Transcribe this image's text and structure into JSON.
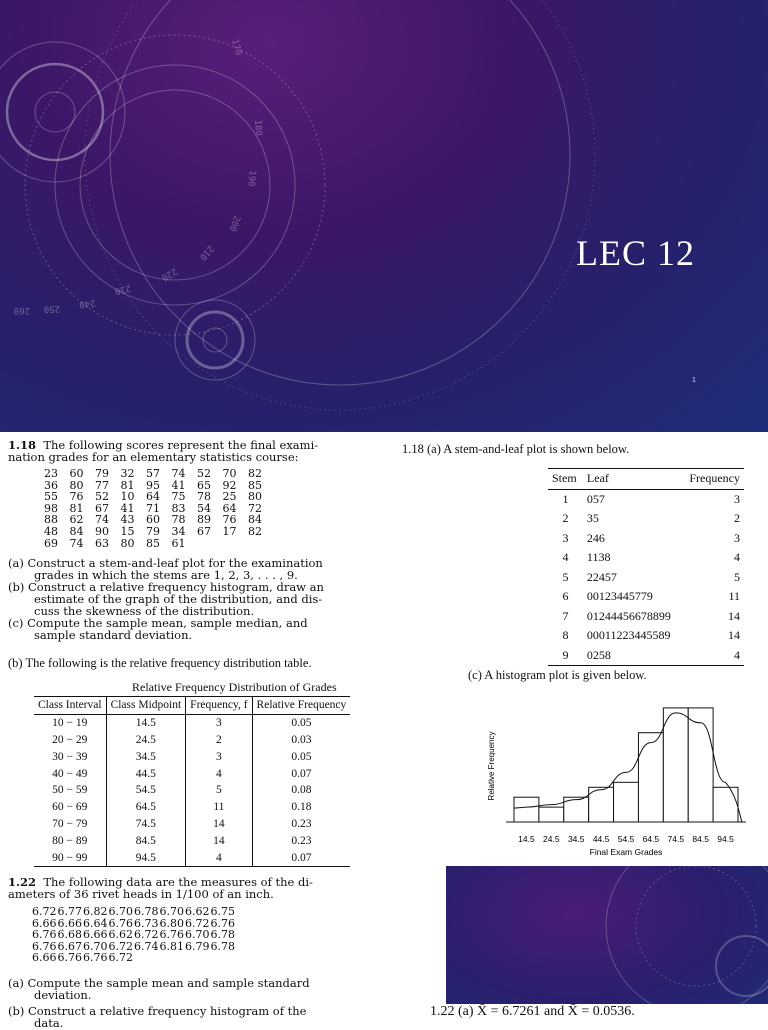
{
  "slide": {
    "title": "LEC 12",
    "slide_number": "1",
    "decor_numbers": [
      "170",
      "180",
      "190",
      "200",
      "210",
      "220",
      "230",
      "240",
      "250",
      "260"
    ]
  },
  "q118": {
    "heading_num": "1.18",
    "statement_line1": "The following scores represent the final exami-",
    "statement_line2": "nation grades for an elementary statistics course:",
    "scores": [
      [
        "23",
        "60",
        "79",
        "32",
        "57",
        "74",
        "52",
        "70",
        "82"
      ],
      [
        "36",
        "80",
        "77",
        "81",
        "95",
        "41",
        "65",
        "92",
        "85"
      ],
      [
        "55",
        "76",
        "52",
        "10",
        "64",
        "75",
        "78",
        "25",
        "80"
      ],
      [
        "98",
        "81",
        "67",
        "41",
        "71",
        "83",
        "54",
        "64",
        "72"
      ],
      [
        "88",
        "62",
        "74",
        "43",
        "60",
        "78",
        "89",
        "76",
        "84"
      ],
      [
        "48",
        "84",
        "90",
        "15",
        "79",
        "34",
        "67",
        "17",
        "82"
      ],
      [
        "69",
        "74",
        "63",
        "80",
        "85",
        "61"
      ]
    ],
    "part_a": [
      "(a) Construct a stem-and-leaf plot for the examination",
      "grades in which the stems are 1, 2, 3, . . . , 9."
    ],
    "part_b": [
      "(b) Construct a relative frequency histogram, draw an",
      "estimate of the graph of the distribution, and dis-",
      "cuss the skewness of the distribution."
    ],
    "part_c": [
      "(c) Compute the sample mean, sample median, and",
      "sample standard deviation."
    ]
  },
  "answer_b": {
    "intro": "(b) The following is the relative frequency distribution table.",
    "table_title": "Relative Frequency Distribution of Grades",
    "headers": [
      "Class Interval",
      "Class Midpoint",
      "Frequency, f",
      "Relative Frequency"
    ],
    "rows": [
      [
        "10 − 19",
        "14.5",
        "3",
        "0.05"
      ],
      [
        "20 − 29",
        "24.5",
        "2",
        "0.03"
      ],
      [
        "30 − 39",
        "34.5",
        "3",
        "0.05"
      ],
      [
        "40 − 49",
        "44.5",
        "4",
        "0.07"
      ],
      [
        "50 − 59",
        "54.5",
        "5",
        "0.08"
      ],
      [
        "60 − 69",
        "64.5",
        "11",
        "0.18"
      ],
      [
        "70 − 79",
        "74.5",
        "14",
        "0.23"
      ],
      [
        "80 − 89",
        "84.5",
        "14",
        "0.23"
      ],
      [
        "90 − 99",
        "94.5",
        "4",
        "0.07"
      ]
    ]
  },
  "answer_a": {
    "intro": "1.18  (a) A stem-and-leaf plot is shown below.",
    "headers": [
      "Stem",
      "Leaf",
      "Frequency"
    ],
    "rows": [
      [
        "1",
        "057",
        "3"
      ],
      [
        "2",
        "35",
        "2"
      ],
      [
        "3",
        "246",
        "3"
      ],
      [
        "4",
        "1138",
        "4"
      ],
      [
        "5",
        "22457",
        "5"
      ],
      [
        "6",
        "00123445779",
        "11"
      ],
      [
        "7",
        "01244456678899",
        "14"
      ],
      [
        "8",
        "00011223445589",
        "14"
      ],
      [
        "9",
        "0258",
        "4"
      ]
    ]
  },
  "answer_c": {
    "intro": "(c) A histogram plot is given below."
  },
  "chart_data": {
    "type": "bar",
    "categories": [
      "14.5",
      "24.5",
      "34.5",
      "44.5",
      "54.5",
      "64.5",
      "74.5",
      "84.5",
      "94.5"
    ],
    "values": [
      0.05,
      0.03,
      0.05,
      0.07,
      0.08,
      0.18,
      0.23,
      0.23,
      0.07
    ],
    "xlabel": "Final Exam Grades",
    "ylabel": "Relative Frequency",
    "ylim": [
      0,
      0.25
    ],
    "grid": false,
    "curve": "smooth density estimate overlaid"
  },
  "q122": {
    "heading_num": "1.22",
    "statement_line1": "The following data are the measures of the di-",
    "statement_line2": "ameters of 36 rivet heads in 1/100 of an inch.",
    "data": [
      [
        "6.72",
        "6.77",
        "6.82",
        "6.70",
        "6.78",
        "6.70",
        "6.62",
        "6.75"
      ],
      [
        "6.66",
        "6.66",
        "6.64",
        "6.76",
        "6.73",
        "6.80",
        "6.72",
        "6.76"
      ],
      [
        "6.76",
        "6.68",
        "6.66",
        "6.62",
        "6.72",
        "6.76",
        "6.70",
        "6.78"
      ],
      [
        "6.76",
        "6.67",
        "6.70",
        "6.72",
        "6.74",
        "6.81",
        "6.79",
        "6.78"
      ],
      [
        "6.66",
        "6.76",
        "6.76",
        "6.72"
      ]
    ],
    "part_a": [
      "(a) Compute the sample mean and sample standard",
      "deviation."
    ],
    "part_b": [
      "(b) Construct a relative frequency histogram of the",
      "data."
    ],
    "answer": "1.22  (a) X̄ = 6.7261 and X̄ = 0.0536."
  }
}
